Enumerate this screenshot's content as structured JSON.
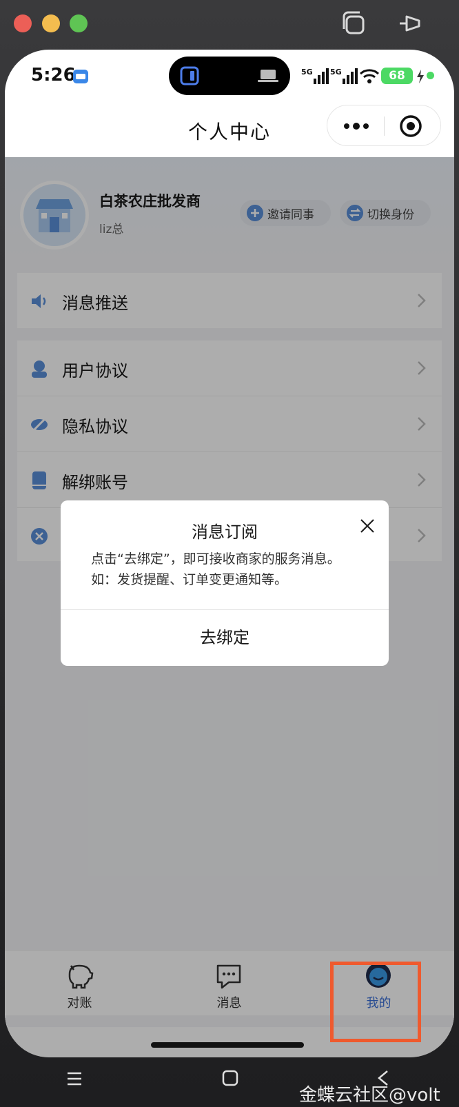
{
  "status_bar": {
    "time": "5:26",
    "signal_1": "5G",
    "signal_2": "5G",
    "battery": "68"
  },
  "navbar": {
    "title": "个人中心"
  },
  "profile": {
    "store_name": "白茶农庄批发商",
    "user_name": "liz总",
    "invite_label": "邀请同事",
    "switch_label": "切换身份"
  },
  "menu": {
    "message_push": "消息推送",
    "user_agreement": "用户协议",
    "privacy_agreement": "隐私协议",
    "unbind_account": "解绑账号"
  },
  "dialog": {
    "title": "消息订阅",
    "body": "点击“去绑定”，即可接收商家的服务消息。如：发货提醒、订单变更通知等。",
    "action": "去绑定"
  },
  "tabbar": {
    "tabs": [
      {
        "label": "对账",
        "icon": "piggy-bank-icon"
      },
      {
        "label": "消息",
        "icon": "chat-bubble-icon"
      },
      {
        "label": "我的",
        "icon": "profile-face-icon"
      }
    ],
    "active_color": "#3a6fd8"
  },
  "watermark": "金蝶云社区@volt",
  "colors": {
    "accent": "#3a6fd8",
    "highlight": "#ef5a2e"
  }
}
